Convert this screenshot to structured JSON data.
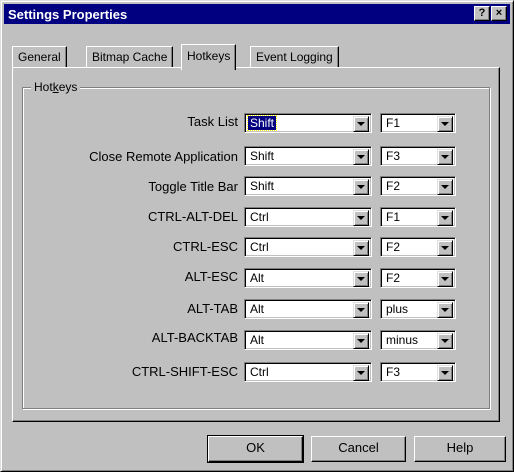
{
  "window": {
    "title": "Settings Properties",
    "help_glyph": "?",
    "close_glyph": "×"
  },
  "tabs": [
    {
      "label": "General"
    },
    {
      "label": "Bitmap Cache"
    },
    {
      "label": "Hotkeys"
    },
    {
      "label": "Event Logging"
    }
  ],
  "group": {
    "label_pre": "Hot",
    "label_u": "k",
    "label_post": "eys"
  },
  "hotkeys": [
    {
      "label": "Task List",
      "modifier": "Shift",
      "key": "F1"
    },
    {
      "label": "Close Remote Application",
      "modifier": "Shift",
      "key": "F3"
    },
    {
      "label": "Toggle Title Bar",
      "modifier": "Shift",
      "key": "F2"
    },
    {
      "label": "CTRL-ALT-DEL",
      "modifier": "Ctrl",
      "key": "F1"
    },
    {
      "label": "CTRL-ESC",
      "modifier": "Ctrl",
      "key": "F2"
    },
    {
      "label": "ALT-ESC",
      "modifier": "Alt",
      "key": "F2"
    },
    {
      "label": "ALT-TAB",
      "modifier": "Alt",
      "key": "plus"
    },
    {
      "label": "ALT-BACKTAB",
      "modifier": "Alt",
      "key": "minus"
    },
    {
      "label": "CTRL-SHIFT-ESC",
      "modifier": "Ctrl",
      "key": "F3"
    }
  ],
  "buttons": {
    "ok": "OK",
    "cancel": "Cancel",
    "help": "Help"
  }
}
